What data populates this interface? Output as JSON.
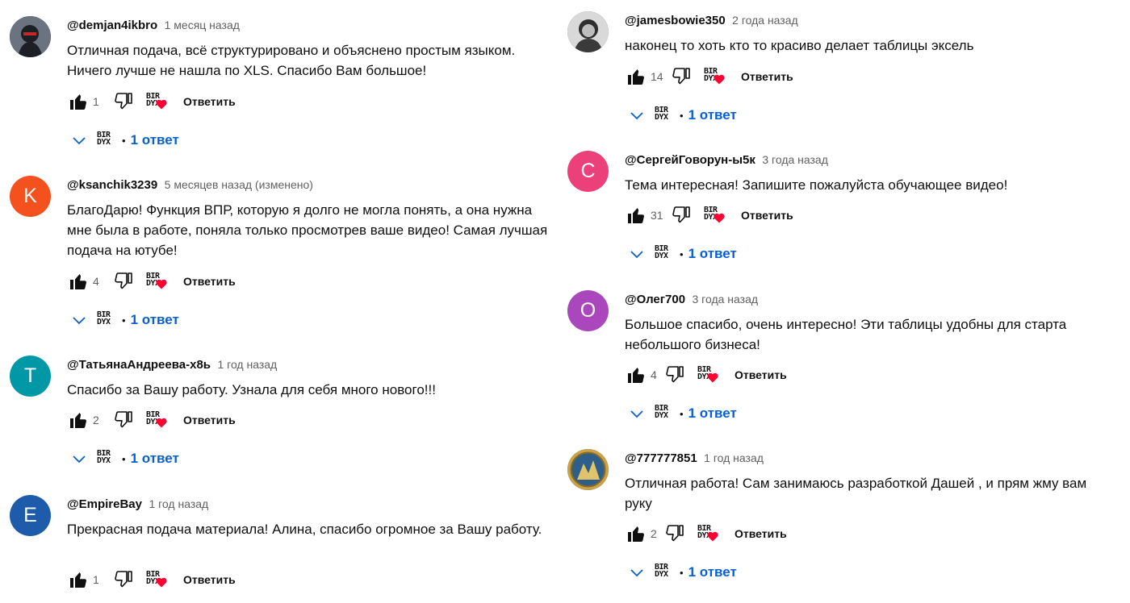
{
  "ui": {
    "reply_label": "Ответить",
    "replies_label": "1 ответ",
    "creator_badge_text": "BIR DYX",
    "dot": "•",
    "heart_color": "#ff0033",
    "link_color": "#065fd4"
  },
  "comments": [
    {
      "author": "@demjan4ikbro",
      "time": "1 месяц назад",
      "avatar": {
        "type": "photo",
        "letter": "",
        "color": "#3a3f4a"
      },
      "text": "Отличная подача, всё структурировано и объяснено простым языком. Ничего лучше не нашла по XLS. Спасибо Вам большое!",
      "likes": "1",
      "replies": "1 ответ"
    },
    {
      "author": "@ksanchik3239",
      "time": "5 месяцев назад (изменено)",
      "avatar": {
        "type": "letter",
        "letter": "K",
        "color": "#f4511e"
      },
      "text": "БлагоДарю! Функция ВПР, которую я долго не могла понять, а она нужна мне была в работе, поняла только просмотрев ваше видео! Самая лучшая подача на ютубе!",
      "likes": "4",
      "replies": "1 ответ"
    },
    {
      "author": "@ТатьянаАндреева-х8ь",
      "time": "1 год назад",
      "avatar": {
        "type": "letter",
        "letter": "Т",
        "color": "#0097a7"
      },
      "text": "Спасибо за Вашу работу. Узнала для себя много нового!!!",
      "likes": "2",
      "replies": "1 ответ"
    },
    {
      "author": "@EmpireBay",
      "time": "1 год назад",
      "avatar": {
        "type": "letter",
        "letter": "E",
        "color": "#1e5bab"
      },
      "text": "Прекрасная подача материала! Алина, спасибо огромное за Вашу работу.",
      "likes": "1",
      "replies": ""
    },
    {
      "author": "@jamesbowie350",
      "time": "2 года назад",
      "avatar": {
        "type": "photo",
        "letter": "",
        "color": "#4a4a4a"
      },
      "text": "наконец то хоть кто то красиво делает таблицы эксель",
      "likes": "14",
      "replies": "1 ответ"
    },
    {
      "author": "@СергейГоворун-ы5к",
      "time": "3 года назад",
      "avatar": {
        "type": "letter",
        "letter": "C",
        "color": "#ec407a"
      },
      "text": "Тема интересная! Запишите пожалуйста обучающее видео!",
      "likes": "31",
      "replies": "1 ответ"
    },
    {
      "author": "@Олег700",
      "time": "3 года назад",
      "avatar": {
        "type": "letter",
        "letter": "О",
        "color": "#ab47bc"
      },
      "text": "Большое спасибо, очень интересно! Эти таблицы удобны для старта небольшого бизнеса!",
      "likes": "4",
      "replies": "1 ответ"
    },
    {
      "author": "@777777851",
      "time": "1 год назад",
      "avatar": {
        "type": "photo",
        "letter": "",
        "color": "#2d5f8a"
      },
      "text": "Отличная работа! Сам занимаюсь разработкой Дашей , и прям жму вам руку",
      "likes": "2",
      "replies": "1 ответ"
    }
  ]
}
